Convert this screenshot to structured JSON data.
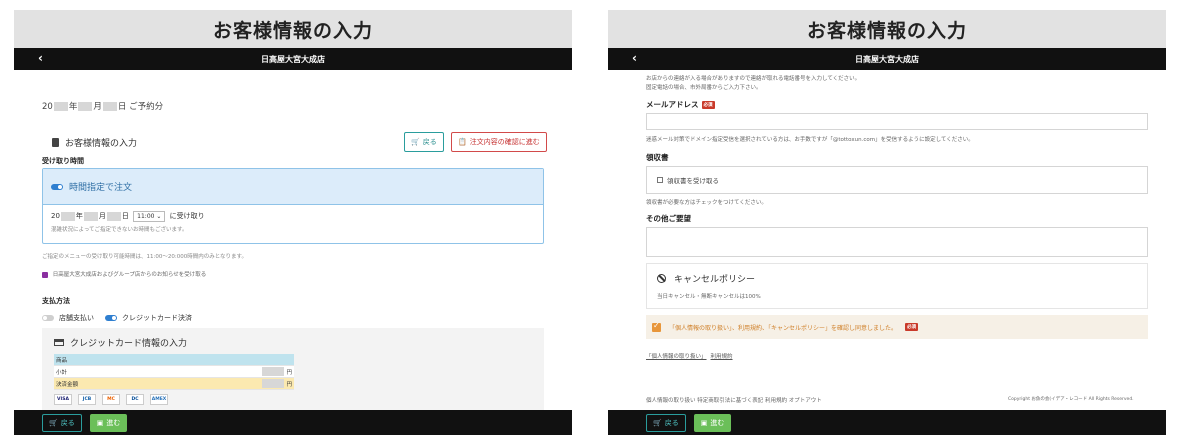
{
  "left": {
    "banner_title": "お客様情報の入力",
    "nav_title": "日高屋大宮大成店",
    "nav_back": "‹",
    "reserve_prefix": "20",
    "reserve_year": "年",
    "reserve_month": "月",
    "reserve_day": "日",
    "reserve_suffix": "ご予約分",
    "section_title": "お客様情報の入力",
    "back_button": "戻る",
    "confirm_button": "注文内容の確認に進む",
    "pickup_label": "受け取り時間",
    "time_toggle_label": "時間指定で注文",
    "time_select": "11:00",
    "time_receive": "に受け取り",
    "time_note": "混雑状況によってご指定できないお時間もございます。",
    "menu_note": "ご指定のメニューの受け取り可能時間は、11:00～20:000時間内のみとなります。",
    "notify_check": "日高屋大宮大成店およびグループ店からのお知らせを受け取る",
    "payment_label": "支払方法",
    "pay_store": "店舗支払い",
    "pay_card": "クレジットカード決済",
    "cc_title": "クレジットカード情報の入力",
    "cc_rows": {
      "item": "商品",
      "subtotal": "小計",
      "total": "決済金額",
      "yen": "円"
    },
    "brands": [
      "VISA",
      "JCB",
      "MC",
      "DC",
      "AMEX"
    ],
    "footer_back": "戻る",
    "footer_next": "進む"
  },
  "right": {
    "banner_title": "お客様情報の入力",
    "nav_title": "日高屋大宮大成店",
    "nav_back": "‹",
    "top_note_1": "お店からの連絡が入る場合がありますので連絡が取れる電話番号を入力してください。",
    "top_note_2": "固定電話の場合、市外局番からご入力下さい。",
    "email_label": "メールアドレス",
    "required": "必須",
    "email_note": "迷惑メール対策でドメイン指定受信を選択されている方は、お手数ですが「@tottoxun.com」を受信するように設定してください。",
    "receipt_label": "領収書",
    "receipt_check": "領収書を受け取る",
    "receipt_note": "領収書が必要な方はチェックをつけてください。",
    "request_label": "その他ご要望",
    "cancel_title": "キャンセルポリシー",
    "cancel_text": "当日キャンセル・無断キャンセルは100%",
    "agree_text": "「個人情報の取り扱い」、利用規約、「キャンセルポリシー」を確認し同意しました。",
    "links_privacy": "「個人情報の取り扱い」",
    "links_terms": "利用規約",
    "footer_links": "個人情報の取り扱い  特定商取引法に基づく表記  利用規約  オプトアウト",
    "copyright": "Copyright お魚の会(イデア・レコード All Rights Reserved.",
    "footer_back": "戻る",
    "footer_next": "進む"
  }
}
